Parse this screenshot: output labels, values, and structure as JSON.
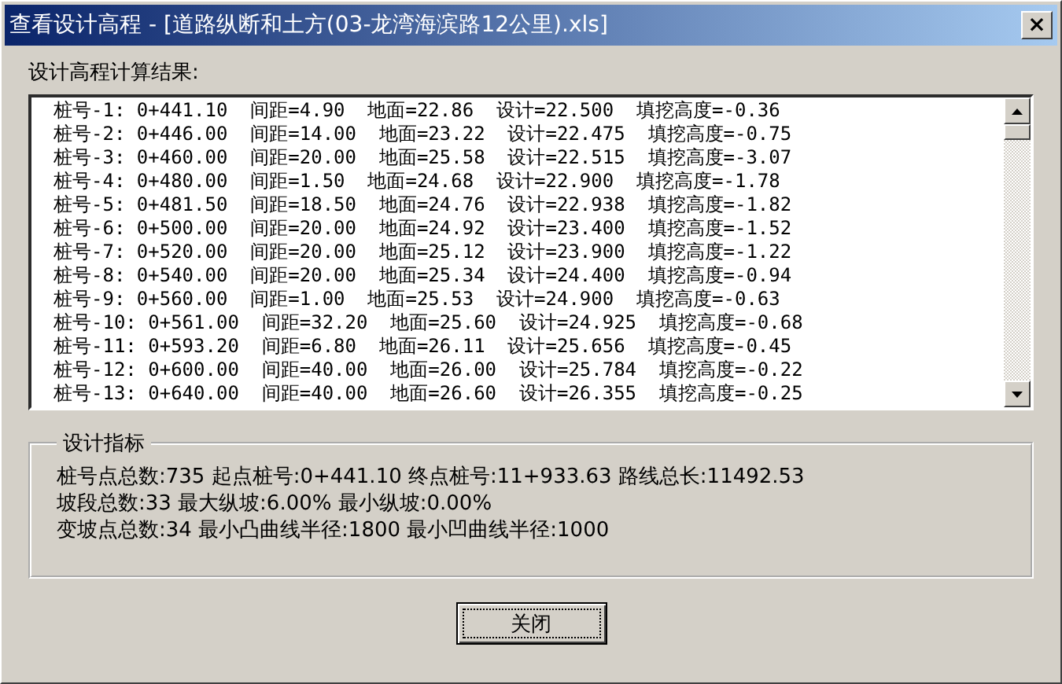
{
  "window": {
    "title": "查看设计高程 - [道路纵断和土方(03-龙湾海滨路12公里).xls]",
    "close": "×"
  },
  "results_label": "设计高程计算结果:",
  "results": [
    "桩号-1: 0+441.10  间距=4.90  地面=22.86  设计=22.500  填挖高度=-0.36",
    "桩号-2: 0+446.00  间距=14.00  地面=23.22  设计=22.475  填挖高度=-0.75",
    "桩号-3: 0+460.00  间距=20.00  地面=25.58  设计=22.515  填挖高度=-3.07",
    "桩号-4: 0+480.00  间距=1.50  地面=24.68  设计=22.900  填挖高度=-1.78",
    "桩号-5: 0+481.50  间距=18.50  地面=24.76  设计=22.938  填挖高度=-1.82",
    "桩号-6: 0+500.00  间距=20.00  地面=24.92  设计=23.400  填挖高度=-1.52",
    "桩号-7: 0+520.00  间距=20.00  地面=25.12  设计=23.900  填挖高度=-1.22",
    "桩号-8: 0+540.00  间距=20.00  地面=25.34  设计=24.400  填挖高度=-0.94",
    "桩号-9: 0+560.00  间距=1.00  地面=25.53  设计=24.900  填挖高度=-0.63",
    "桩号-10: 0+561.00  间距=32.20  地面=25.60  设计=24.925  填挖高度=-0.68",
    "桩号-11: 0+593.20  间距=6.80  地面=26.11  设计=25.656  填挖高度=-0.45",
    "桩号-12: 0+600.00  间距=40.00  地面=26.00  设计=25.784  填挖高度=-0.22",
    "桩号-13: 0+640.00  间距=40.00  地面=26.60  设计=26.355  填挖高度=-0.25"
  ],
  "indicators": {
    "title": "设计指标",
    "lines": [
      "桩号点总数:735  起点桩号:0+441.10  终点桩号:11+933.63  路线总长:11492.53",
      "坡段总数:33  最大纵坡:6.00%  最小纵坡:0.00%",
      "变坡点总数:34  最小凸曲线半径:1800  最小凹曲线半径:1000"
    ]
  },
  "buttons": [
    "关闭"
  ]
}
